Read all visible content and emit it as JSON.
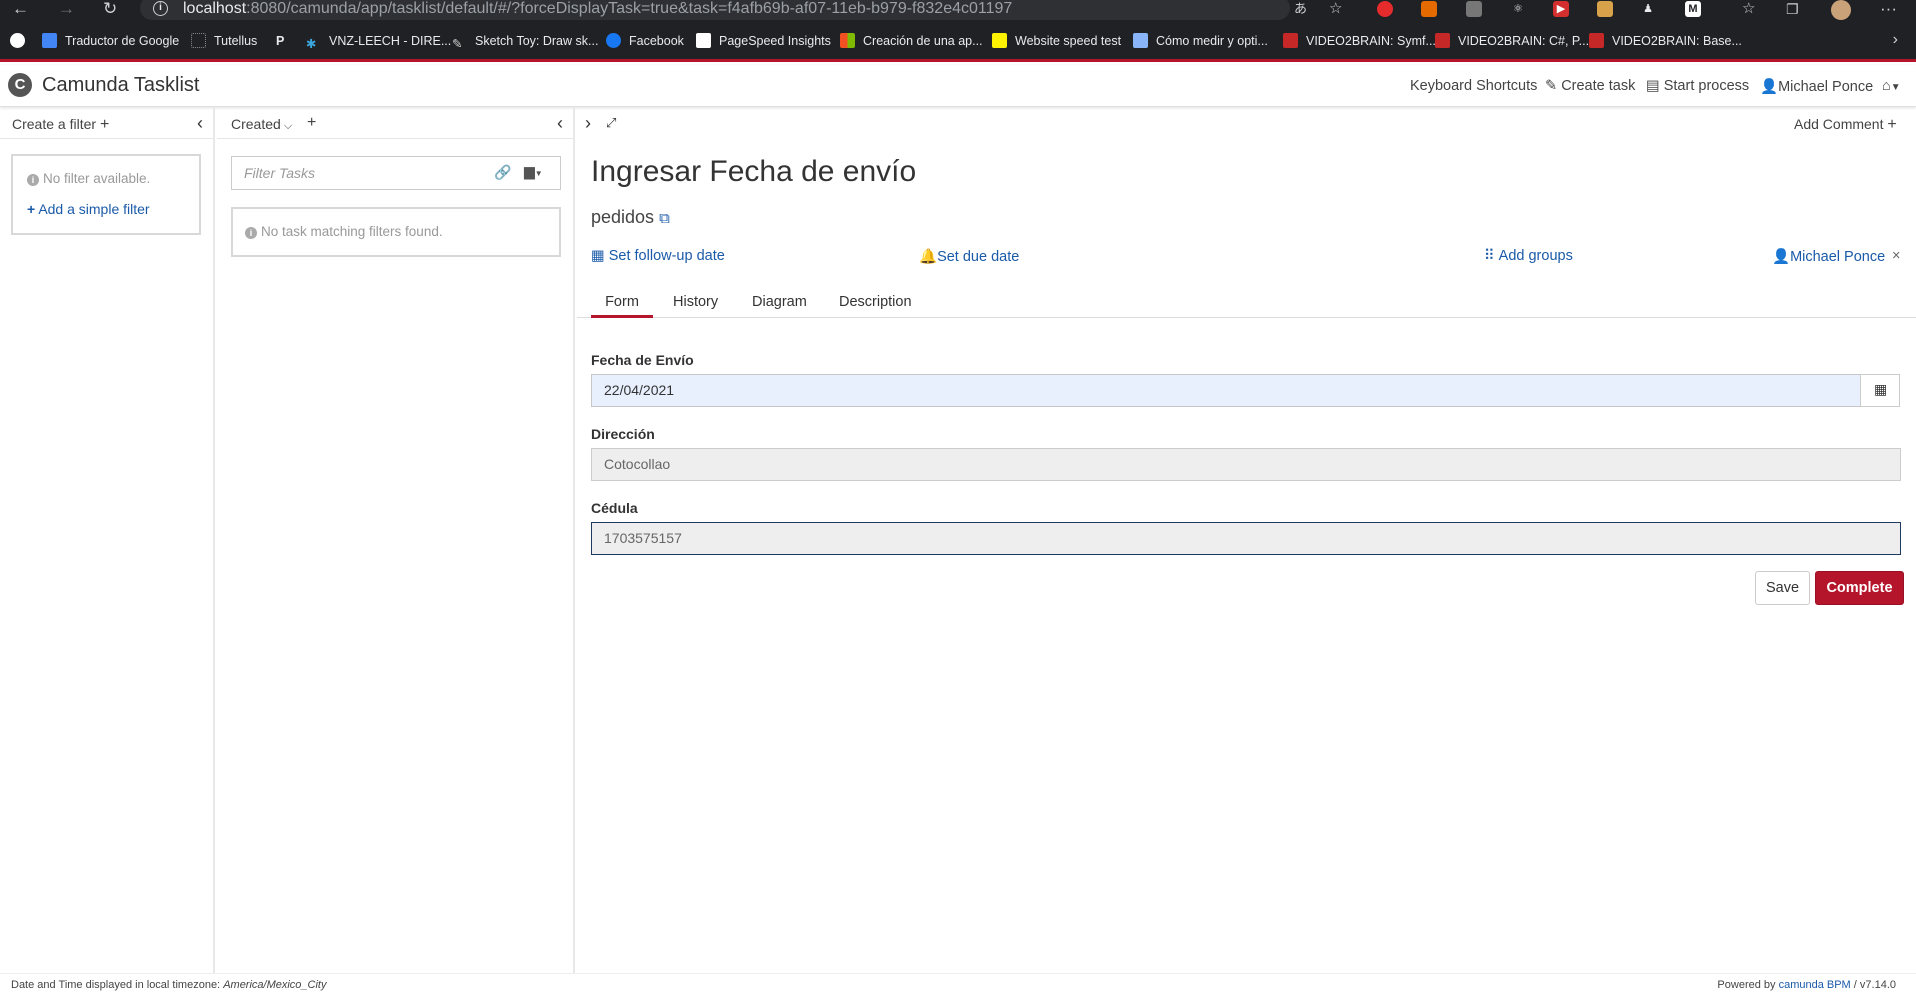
{
  "browser": {
    "url_host": "localhost",
    "url_path": ":8080/camunda/app/tasklist/default/#/?forceDisplayTask=true&task=f4afb69b-af07-11eb-b979-f832e4c01197",
    "bookmarks": [
      {
        "label": "",
        "icon": "github-icon",
        "color": "#ffffff"
      },
      {
        "label": "Traductor de Google",
        "icon": "google-translate-icon",
        "color": "#4285f4"
      },
      {
        "label": "Tutellus",
        "icon": "tutellus-icon",
        "color": "#202124"
      },
      {
        "label": "",
        "icon": "p-icon",
        "color": "#202124"
      },
      {
        "label": "VNZ-LEECH - DIRE...",
        "icon": "star-icon",
        "color": "#3aa6dd"
      },
      {
        "label": "Sketch Toy: Draw sk...",
        "icon": "sketch-icon",
        "color": "#202124"
      },
      {
        "label": "Facebook",
        "icon": "facebook-icon",
        "color": "#1877f2"
      },
      {
        "label": "PageSpeed Insights",
        "icon": "pagespeed-icon",
        "color": "#ffffff"
      },
      {
        "label": "Creación de una ap...",
        "icon": "microsoft-icon",
        "color": "#f25022"
      },
      {
        "label": "Website speed test",
        "icon": "pingdom-icon",
        "color": "#fff200"
      },
      {
        "label": "Cómo medir y opti...",
        "icon": "page-icon",
        "color": "#8ab4f8"
      },
      {
        "label": "VIDEO2BRAIN: Symf...",
        "icon": "video2brain-icon",
        "color": "#c62828"
      },
      {
        "label": "VIDEO2BRAIN: C#, P...",
        "icon": "video2brain-icon",
        "color": "#c62828"
      },
      {
        "label": "VIDEO2BRAIN: Base...",
        "icon": "video2brain-icon",
        "color": "#c62828"
      }
    ]
  },
  "header": {
    "app_title": "Camunda Tasklist",
    "logo_letter": "C",
    "keyboard_shortcuts": "Keyboard Shortcuts",
    "create_task": "Create task",
    "start_process": "Start process",
    "user": "Michael Ponce"
  },
  "filters_panel": {
    "create_label": "Create a filter",
    "empty_text": "No filter available.",
    "add_simple_filter": "Add a simple filter"
  },
  "list_panel": {
    "sort_label": "Created",
    "filter_placeholder": "Filter Tasks",
    "empty_text": "No task matching filters found."
  },
  "task": {
    "add_comment": "Add Comment",
    "title": "Ingresar Fecha de envío",
    "process_name": "pedidos",
    "actions": {
      "follow_up": "Set follow-up date",
      "due_date": "Set due date",
      "add_groups": "Add groups",
      "assignee": "Michael Ponce"
    },
    "tabs": [
      "Form",
      "History",
      "Diagram",
      "Description"
    ],
    "active_tab": "Form",
    "form": {
      "fields": [
        {
          "label": "Fecha de Envío",
          "value": "22/04/2021"
        },
        {
          "label": "Dirección",
          "value": "Cotocollao"
        },
        {
          "label": "Cédula",
          "value": "1703575157"
        }
      ],
      "save": "Save",
      "complete": "Complete"
    }
  },
  "footer": {
    "timezone_prefix": "Date and Time displayed in local timezone:",
    "timezone": "America/Mexico_City",
    "powered_by": "Powered by",
    "brand": "camunda BPM",
    "version": "/ v7.14.0"
  },
  "colors": {
    "brand_red": "#b5152b",
    "link_blue": "#1a5aa8",
    "date_field_bg": "#e8f0fe",
    "readonly_bg": "#eeeeee"
  }
}
